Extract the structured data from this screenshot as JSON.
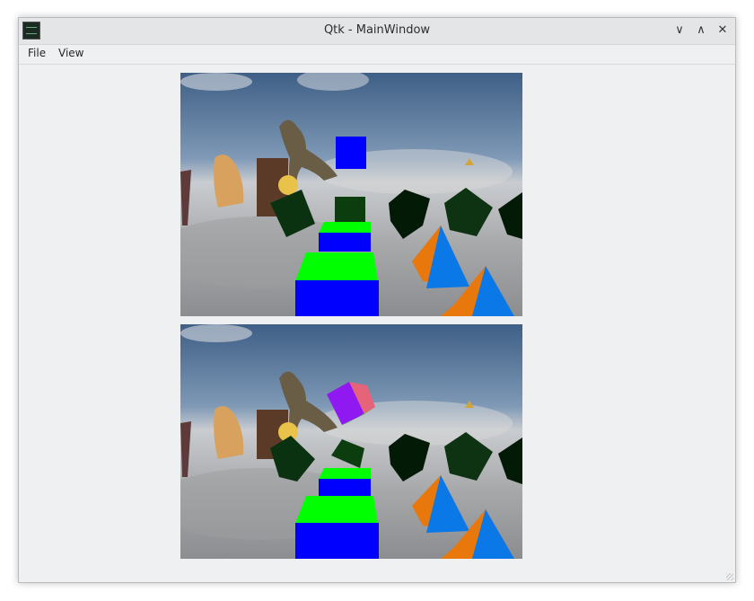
{
  "window": {
    "title": "Qtk - MainWindow",
    "app_icon": "terminal-icon",
    "controls": {
      "minimize": "∨",
      "maximize": "∧",
      "close": "✕"
    }
  },
  "menubar": {
    "items": [
      {
        "label": "File"
      },
      {
        "label": "View"
      }
    ]
  },
  "viewports": [
    {
      "name": "scene-view-top"
    },
    {
      "name": "scene-view-bottom"
    }
  ],
  "colors": {
    "window_bg": "#eff0f1",
    "titlebar_bg": "#e3e5e7",
    "cube_blue": "#0000ff",
    "cube_green": "#00ff00",
    "cube_dark": "#0b2e10",
    "pyramid_orange": "#e87a0c",
    "pyramid_blue": "#0a78e6"
  }
}
